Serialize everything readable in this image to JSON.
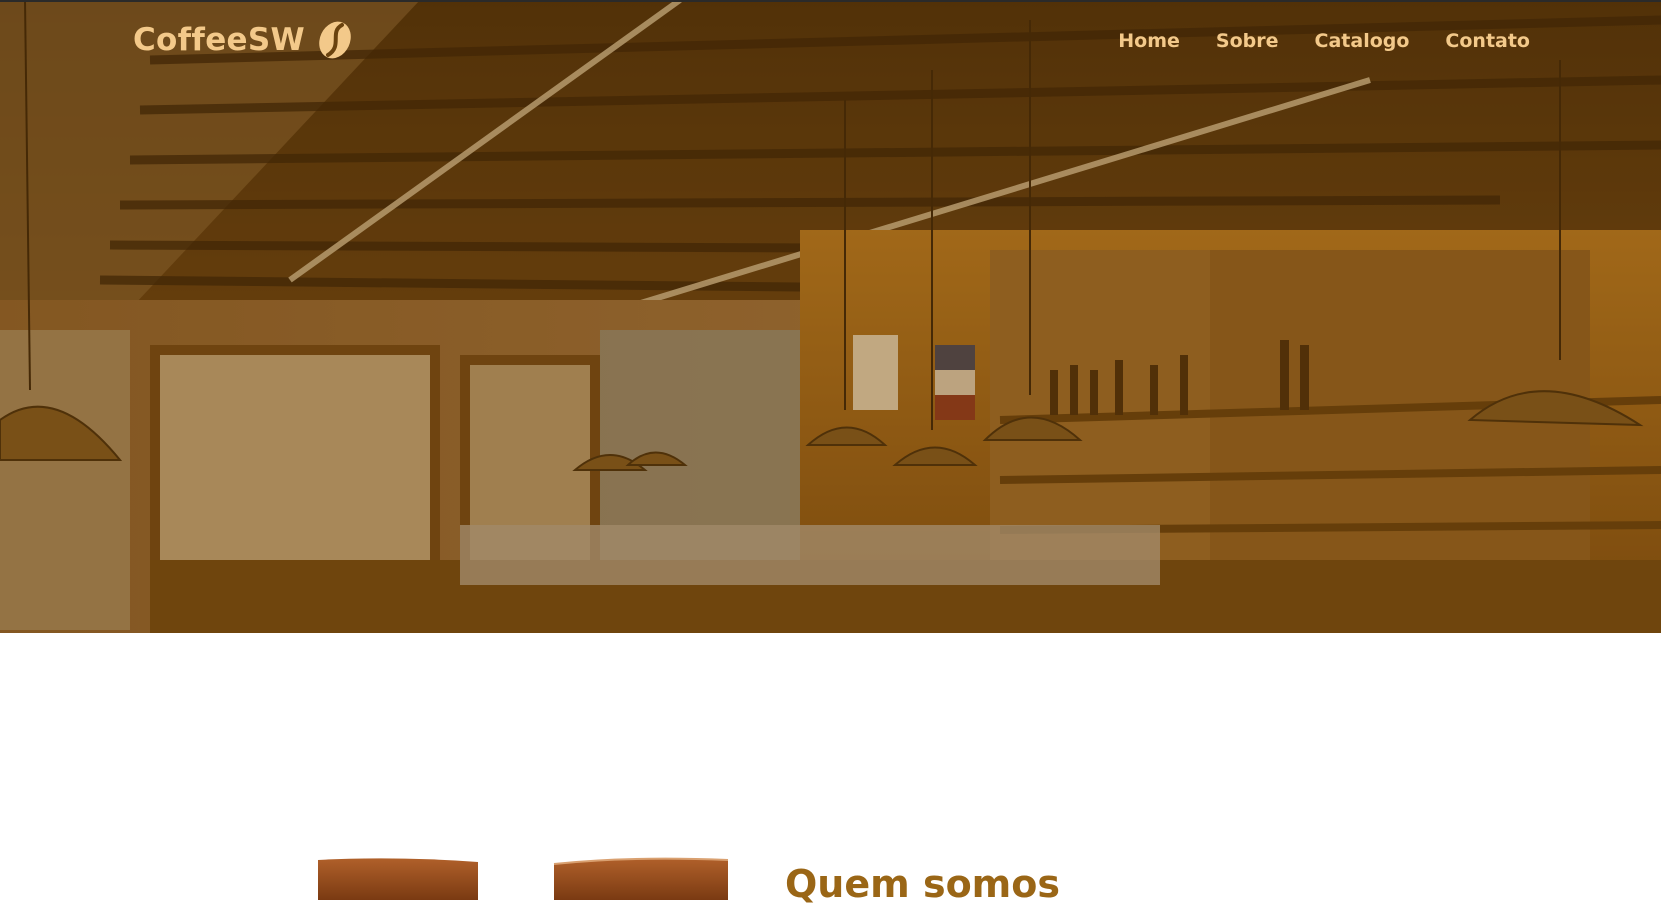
{
  "brand": {
    "name": "CoffeeSW",
    "icon": "coffee-bean-icon",
    "text_color": "#f3c98a"
  },
  "nav": {
    "items": [
      {
        "label": "Home"
      },
      {
        "label": "Sobre"
      },
      {
        "label": "Catalogo"
      },
      {
        "label": "Contato"
      }
    ]
  },
  "hero": {
    "overlay_color": "#78480a"
  },
  "about": {
    "title": "Quem somos",
    "title_color": "#9a6616"
  }
}
